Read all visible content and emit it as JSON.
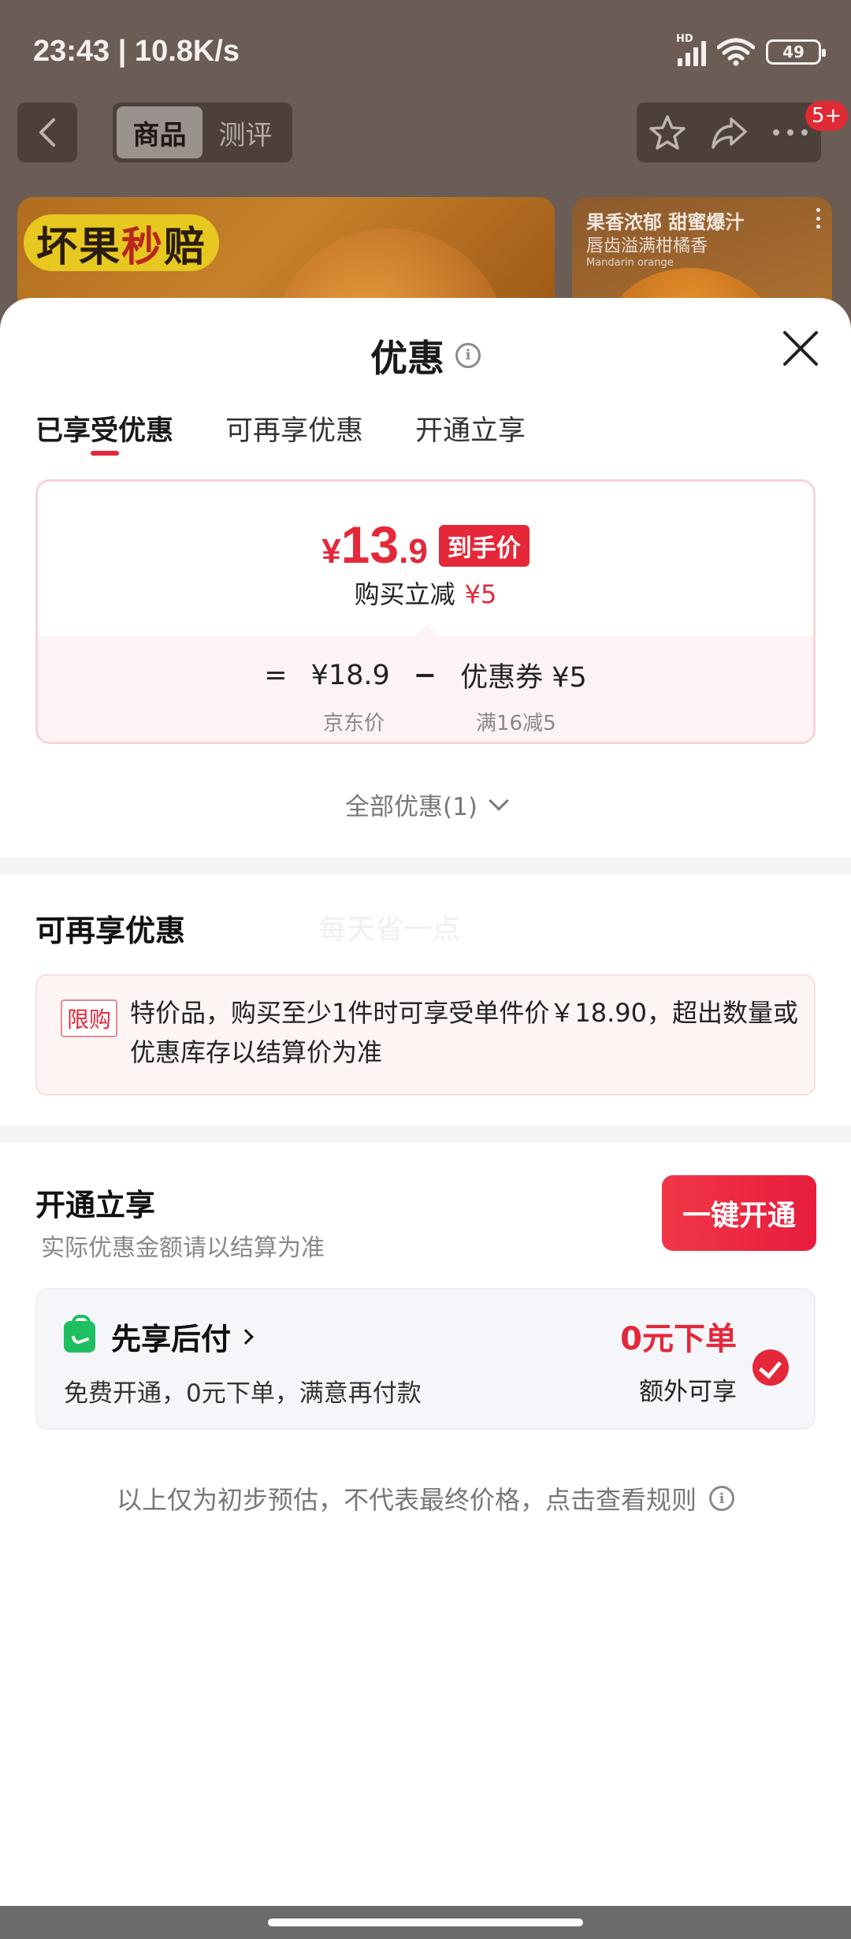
{
  "status_bar": {
    "time": "23:43 | 10.8K/s",
    "signal_label": "HD",
    "battery": "49"
  },
  "background_page": {
    "segments": [
      "商品",
      "测评"
    ],
    "active_segment": "商品",
    "notification_badge": "5+",
    "banner_left_tag": {
      "part1": "坏果",
      "part2": "秒",
      "part3": "赔"
    },
    "banner_right": {
      "line1": "果香浓郁 甜蜜爆汁",
      "line2": "唇齿溢满柑橘香",
      "line3": "Mandarin orange"
    }
  },
  "sheet": {
    "title": "优惠",
    "tabs": [
      {
        "label": "已享受优惠",
        "active": true
      },
      {
        "label": "可再享优惠",
        "active": false
      },
      {
        "label": "开通立享",
        "active": false
      }
    ],
    "enjoyed": {
      "currency": "¥",
      "price_int": "13",
      "price_dec": ".9",
      "price_tag": "到手价",
      "reduce_label": "购买立减",
      "reduce_amount": "¥5",
      "equals": "=",
      "jd_price": "¥18.9",
      "minus": "−",
      "coupon": "优惠券 ¥5",
      "jd_price_label": "京东价",
      "coupon_condition": "满16减5"
    },
    "all_discounts": "全部优惠(1)",
    "more": {
      "title": "可再享优惠",
      "watermark": "每天省一点",
      "limit_tag": "限购",
      "limit_text": "特价品，购买至少1件时可享受单件价￥18.90，超出数量或优惠库存以结算价为准"
    },
    "open": {
      "title": "开通立享",
      "subtitle": "实际优惠金额请以结算为准",
      "button": "一键开通",
      "pay_title": "先享后付",
      "pay_desc": "免费开通，0元下单，满意再付款",
      "pay_zero": "0元下单",
      "pay_extra": "额外可享",
      "checked": true
    },
    "footnote": "以上仅为初步预估，不代表最终价格，点击查看规则"
  }
}
